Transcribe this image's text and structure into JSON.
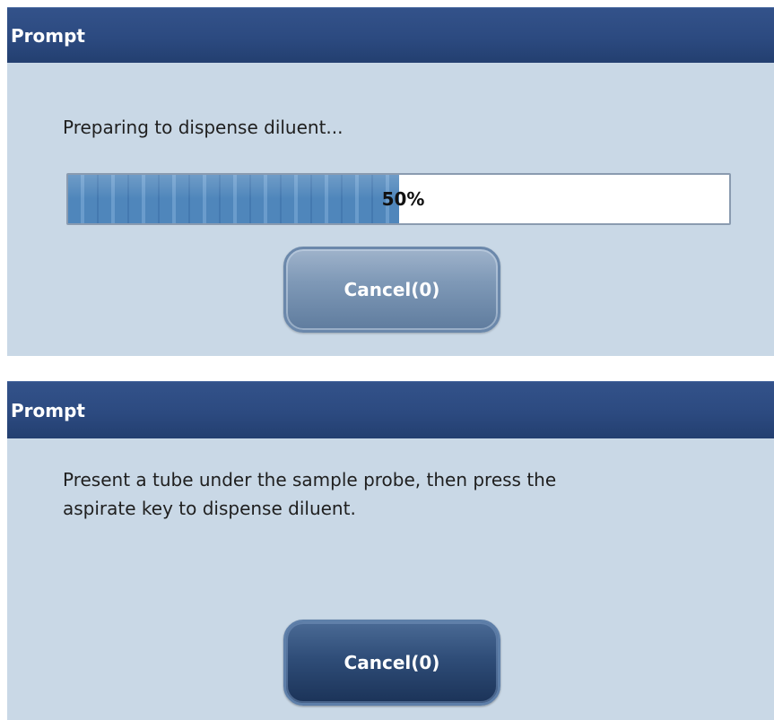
{
  "dialogs": [
    {
      "title": "Prompt",
      "message": "Preparing to dispense diluent...",
      "progress": {
        "percent": 50,
        "label": "50%"
      },
      "cancel_label": "Cancel(0)"
    },
    {
      "title": "Prompt",
      "message": "Present a tube under the sample probe, then press the\naspirate key to dispense diluent.",
      "cancel_label": "Cancel(0)"
    }
  ]
}
